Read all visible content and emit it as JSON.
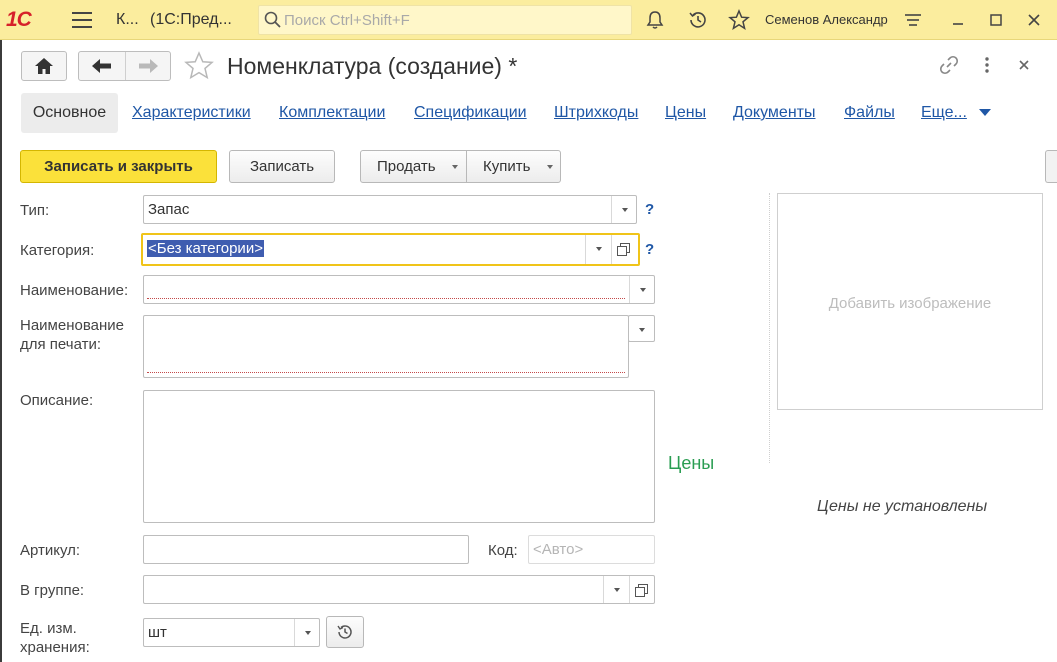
{
  "app": {
    "logo": "1С",
    "title_short": "К...",
    "title_app": "(1С:Пред...",
    "search_placeholder": "Поиск Ctrl+Shift+F",
    "user_name": "Семенов Александр"
  },
  "header": {
    "form_title": "Номенклатура (создание) *"
  },
  "tabs": {
    "active": "Основное",
    "items": [
      "Характеристики",
      "Комплектации",
      "Спецификации",
      "Штрихкоды",
      "Цены",
      "Документы",
      "Файлы",
      "Еще..."
    ]
  },
  "toolbar": {
    "save_close": "Записать и закрыть",
    "save": "Записать",
    "sell": "Продать",
    "buy": "Купить"
  },
  "form": {
    "type_label": "Тип:",
    "type_value": "Запас",
    "category_label": "Категория:",
    "category_value": "<Без категории>",
    "name_label": "Наименование:",
    "name_value": "",
    "print_name_label_1": "Наименование",
    "print_name_label_2": "для печати:",
    "print_name_value": "",
    "description_label": "Описание:",
    "description_value": "",
    "article_label": "Артикул:",
    "article_value": "",
    "code_label": "Код:",
    "code_placeholder": "<Авто>",
    "group_label": "В группе:",
    "group_value": "",
    "unit_label_1": "Ед. изм.",
    "unit_label_2": "хранения:",
    "unit_value": "шт",
    "help_mark": "?"
  },
  "side": {
    "add_image": "Добавить изображение",
    "prices_title": "Цены",
    "prices_empty": "Цены не установлены"
  },
  "colors": {
    "titlebar": "#fbed9e",
    "primary_button": "#fbe13a",
    "link": "#1f57a6",
    "prices_green": "#2a9d52",
    "selection": "#3f5db0"
  }
}
